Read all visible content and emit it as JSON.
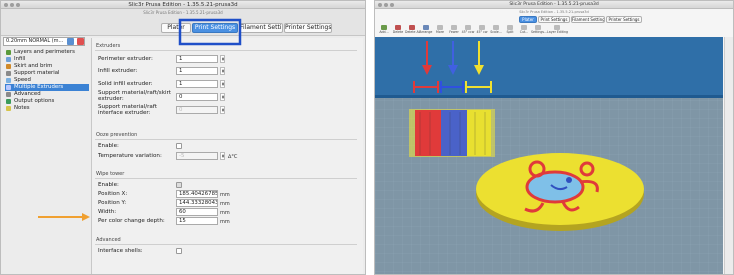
{
  "left_window": {
    "title": "Slic3r Prusa Edition - 1.35.5.21-prusa3d",
    "subtitle": "Slic3r Prusa Edition - 1.35.5.21-prusa3d",
    "tabs": [
      "Plater",
      "Print Settings",
      "Filament Settings",
      "Printer Settings"
    ],
    "active_tab": "Print Settings",
    "preset": "0.20mm NORMAL (m...",
    "sidebar": [
      {
        "label": "Layers and perimeters",
        "icon": "layers-icon",
        "color": "#5a9a3a"
      },
      {
        "label": "Infill",
        "icon": "infill-icon",
        "color": "#6da0d8"
      },
      {
        "label": "Skirt and brim",
        "icon": "skirt-icon",
        "color": "#d08a2a"
      },
      {
        "label": "Support material",
        "icon": "support-icon",
        "color": "#8a8a8a"
      },
      {
        "label": "Speed",
        "icon": "speed-icon",
        "color": "#7ab0e0"
      },
      {
        "label": "Multiple Extruders",
        "icon": "extruders-icon",
        "color": "#6a7fb8"
      },
      {
        "label": "Advanced",
        "icon": "wrench-icon",
        "color": "#8a8a8a"
      },
      {
        "label": "Output options",
        "icon": "output-icon",
        "color": "#3a9a5a"
      },
      {
        "label": "Notes",
        "icon": "notes-icon",
        "color": "#d6c44a"
      }
    ],
    "selected_sidebar": "Multiple Extruders",
    "extruders": {
      "title": "Extruders",
      "perimeter_label": "Perimeter extruder:",
      "perimeter_value": "1",
      "infill_label": "Infill extruder:",
      "infill_value": "1",
      "solid_infill_label": "Solid infill extruder:",
      "solid_infill_value": "1",
      "support_label": "Support material/raft/skirt extruder:",
      "support_value": "0",
      "support_interface_label": "Support material/raft interface extruder:",
      "support_interface_value": "0"
    },
    "ooze": {
      "title": "Ooze prevention",
      "enable_label": "Enable:",
      "temp_label": "Temperature variation:",
      "temp_value": "-5",
      "temp_unit": "∆°C"
    },
    "wipe": {
      "title": "Wipe tower",
      "enable_label": "Enable:",
      "x_label": "Position X:",
      "x_value": "185.40426785",
      "x_unit": "mm",
      "y_label": "Position Y:",
      "y_value": "144.33328043",
      "y_unit": "mm",
      "width_label": "Width:",
      "width_value": "60",
      "width_unit": "mm",
      "depth_label": "Per color change depth:",
      "depth_value": "15",
      "depth_unit": "mm"
    },
    "advanced": {
      "title": "Advanced",
      "shells_label": "Interface shells:"
    }
  },
  "right_window": {
    "title": "Slic3r Prusa Edition - 1.35.5.21-prusa3d",
    "subtitle": "Slic3r Prusa Edition - 1.35.5.21-prusa3d",
    "tabs": [
      "Plater",
      "Print Settings",
      "Filament Settings",
      "Printer Settings"
    ],
    "toolbar": [
      "Add...",
      "Delete",
      "Delete All",
      "Arrange",
      "More",
      "Fewer",
      "45° ccw",
      "45° cw",
      "Scale...",
      "Split",
      "Cut...",
      "Settings...",
      "Layer Editing"
    ]
  },
  "colors": {
    "highlight_box": "#1f4fc8",
    "orange_arrow": "#f0a030",
    "red": "#e03a3a",
    "blue": "#4060e0",
    "yellow": "#f0e030",
    "bed_blue": "#2f6fa8",
    "grid": "#8fa8b8"
  }
}
